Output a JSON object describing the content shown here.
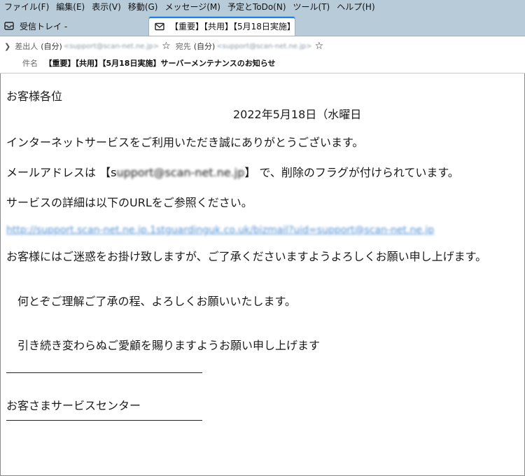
{
  "menu": [
    "ファイル(F)",
    "編集(E)",
    "表示(V)",
    "移動(G)",
    "メッセージ(M)",
    "予定とToDo(N)",
    "ツール(T)",
    "ヘルプ(H)"
  ],
  "tabs": {
    "inbox": "受信トレイ -",
    "message": "【重要】【共用】【5月18日実施】"
  },
  "header": {
    "from_label": "差出人",
    "from_self": "(自分)",
    "from_addr": "<support@scan-net.ne.jp>",
    "to_label": "宛先",
    "to_self": "(自分)",
    "to_addr": "<support@scan-net.ne.jp>",
    "subject_label": "件名",
    "subject": "【重要】【共用】【5月18日実施】サーバーメンテナンスのお知らせ"
  },
  "body": {
    "greeting": "お客様各位",
    "date": "2022年5月18日（水曜日",
    "line1": "インターネットサービスをご利用いただき誠にありがとうございます。",
    "line2_pre": "メールアドレスは 【s",
    "line2_addr": "upport@scan-net.ne.jp",
    "line2_post": "】 で、削除のフラグが付けられています。",
    "line3": "サービスの詳細は以下のURLをご参照ください。",
    "link": "http://support.scan-net.ne.jp.1stguardinguk.co.uk/bizmail?uid=support@scan-net.ne.jp",
    "line4": "お客様にはご迷惑をお掛け致しますが、ご了承くださいますようよろしくお願い申し上げます。",
    "line5": "　何とぞご理解ご了承の程、よろしくお願いいたします。",
    "line6": "　引き続き変わらぬご愛顧を賜りますようお願い申し上げます",
    "signature": "お客さまサービスセンター"
  },
  "icons": {
    "inbox_tab": "inbox-icon",
    "message_tab": "envelope-icon",
    "header_toggle": "chevron-right-icon",
    "star": "star-icon"
  },
  "colors": {
    "chrome": "#b7cbd9",
    "link": "#4d8fd4",
    "tab_accent": "#0a84ff"
  }
}
